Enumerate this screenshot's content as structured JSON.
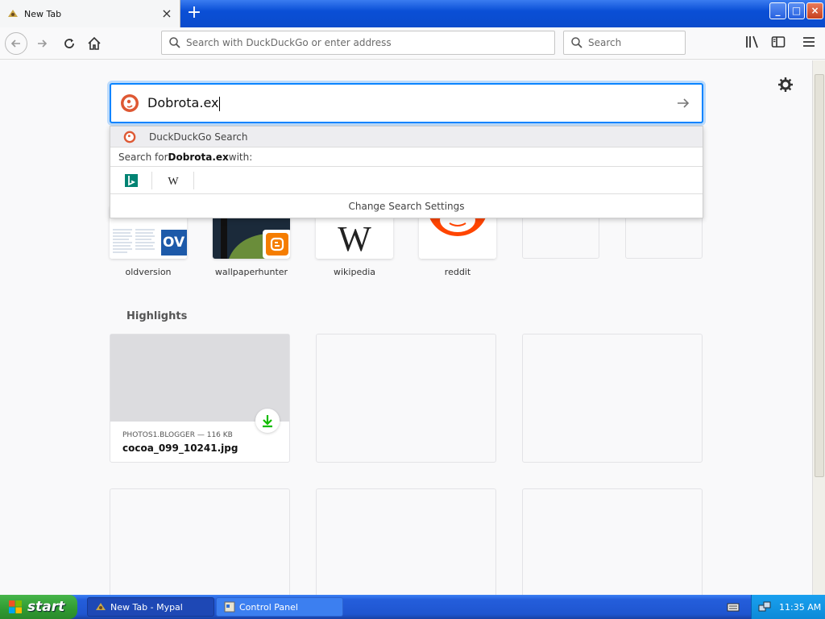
{
  "tab": {
    "title": "New Tab",
    "close": "×"
  },
  "newtab": "+",
  "window": {
    "minimize": "_",
    "maximize": "□",
    "close": "×"
  },
  "urlbar": {
    "placeholder": "Search with DuckDuckGo or enter address"
  },
  "searchbar": {
    "placeholder": "Search"
  },
  "search": {
    "value": "Dobrota.ex"
  },
  "popup": {
    "engine_row": "DuckDuckGo Search",
    "search_for_prefix": "Search for ",
    "search_for_term": "Dobrota.ex",
    "search_for_suffix": " with:",
    "engines": [
      "bing-icon",
      "wikipedia-icon"
    ],
    "settings": "Change Search Settings"
  },
  "topsites": [
    {
      "label": "oldversion",
      "icon": "ov-icon"
    },
    {
      "label": "wallpaperhunter",
      "icon": "blogger-icon"
    },
    {
      "label": "wikipedia",
      "icon": "wikipedia-icon"
    },
    {
      "label": "reddit",
      "icon": "reddit-icon"
    }
  ],
  "highlights": {
    "title": "Highlights",
    "card": {
      "source": "PHOTOS1.BLOGGER — 116 KB",
      "title": "cocoa_099_10241.jpg"
    }
  },
  "taskbar": {
    "start": "start",
    "tasks": [
      "New Tab - Mypal",
      "Control Panel"
    ],
    "clock": "11:35 AM"
  },
  "colors": {
    "accent": "#0a84ff",
    "ddg": "#de5833",
    "reddit": "#ff4500",
    "blogger": "#f57d00",
    "download": "#12bc00"
  }
}
